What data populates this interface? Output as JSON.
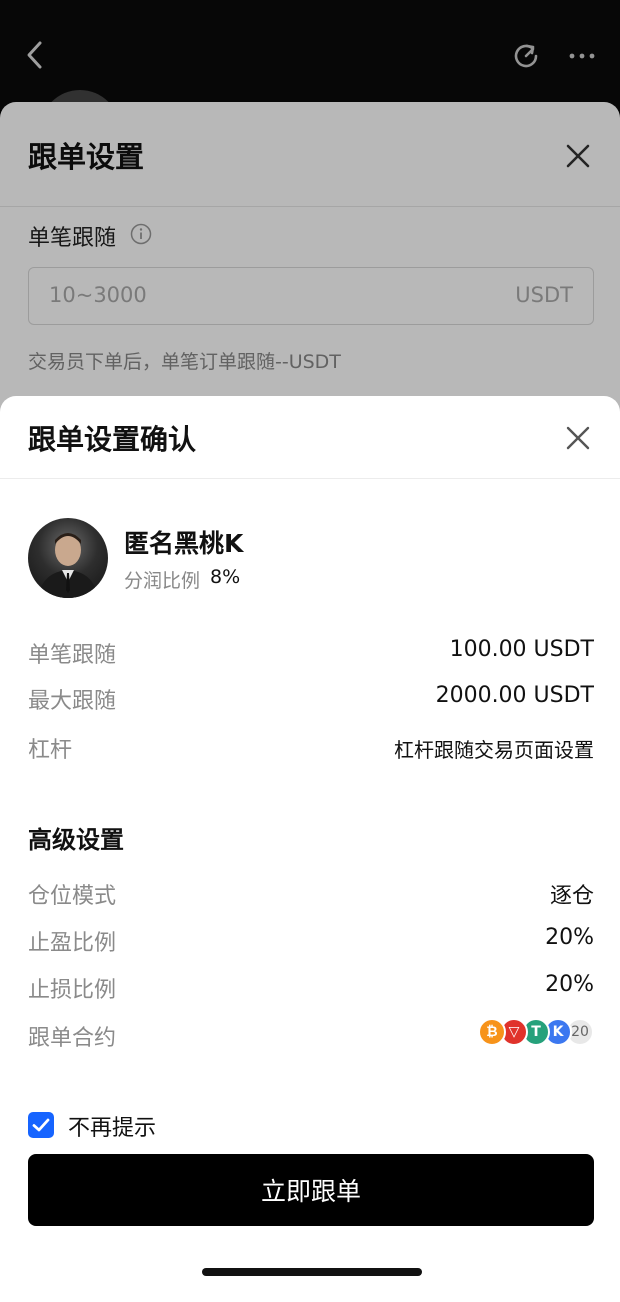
{
  "settings_sheet": {
    "title": "跟单设置",
    "per_order_label": "单笔跟随",
    "amount_placeholder": "10~3000",
    "amount_unit": "USDT",
    "hint": "交易员下单后，单笔订单跟随--USDT"
  },
  "confirm_modal": {
    "title": "跟单设置确认",
    "trader": {
      "name": "匿名黑桃K",
      "profit_share_label": "分润比例",
      "profit_share_value": "8%"
    },
    "rows": [
      {
        "label": "单笔跟随",
        "value": "100.00 USDT"
      },
      {
        "label": "最大跟随",
        "value": "2000.00 USDT"
      },
      {
        "label": "杠杆",
        "value": "杠杆跟随交易页面设置"
      }
    ],
    "advanced": {
      "title": "高级设置",
      "rows": [
        {
          "label": "仓位模式",
          "value": "逐仓"
        },
        {
          "label": "止盈比例",
          "value": "20%"
        },
        {
          "label": "止损比例",
          "value": "20%"
        },
        {
          "label": "跟单合约",
          "value": ""
        }
      ],
      "contracts": {
        "icons": [
          {
            "name": "bitcoin-coin-icon",
            "glyph": "₿",
            "color": "#f7931a"
          },
          {
            "name": "tron-coin-icon",
            "glyph": "▽",
            "color": "#e0332b"
          },
          {
            "name": "tether-coin-icon",
            "glyph": "T",
            "color": "#26a17b"
          },
          {
            "name": "k-coin-icon",
            "glyph": "K",
            "color": "#3c78f0"
          }
        ],
        "count": "20"
      }
    },
    "dont_show_again": "不再提示",
    "confirm_button": "立即跟单"
  }
}
